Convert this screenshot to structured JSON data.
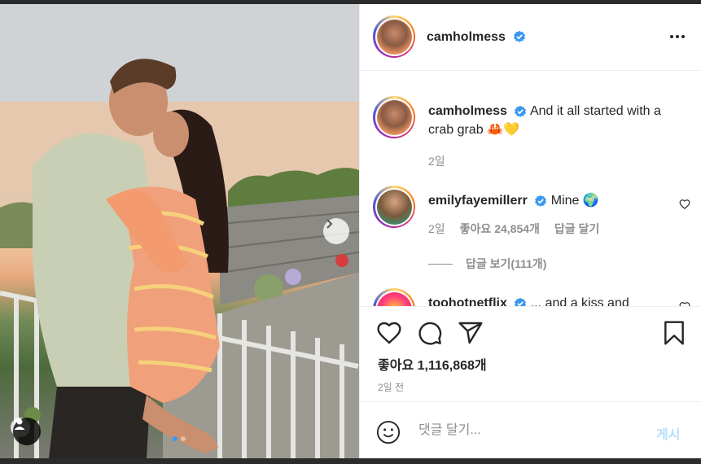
{
  "post": {
    "username": "camholmess",
    "verified": true
  },
  "photo": {
    "carousel_dots": 2,
    "active_dot": 0
  },
  "comments": [
    {
      "username": "camholmess",
      "verified": true,
      "text": "And it all started with a crab grab 🦀💛",
      "time": "2일"
    },
    {
      "username": "emilyfayemillerr",
      "verified": true,
      "text": "Mine 🌍",
      "time": "2일",
      "likes": "좋아요 24,854개",
      "reply": "답글 달기",
      "view_replies": "답글 보기(111개)"
    },
    {
      "username": "toohotnetflix",
      "verified": true,
      "text": "... and a kiss and"
    }
  ],
  "actions": {
    "likes": "좋아요 1,116,868개",
    "time": "2일 전"
  },
  "comment_box": {
    "placeholder": "댓글 달기...",
    "post_label": "게시"
  },
  "colors": {
    "verified_blue": "#3897f0",
    "meta_gray": "#8e8e8e",
    "post_disabled": "#b2dffc"
  }
}
